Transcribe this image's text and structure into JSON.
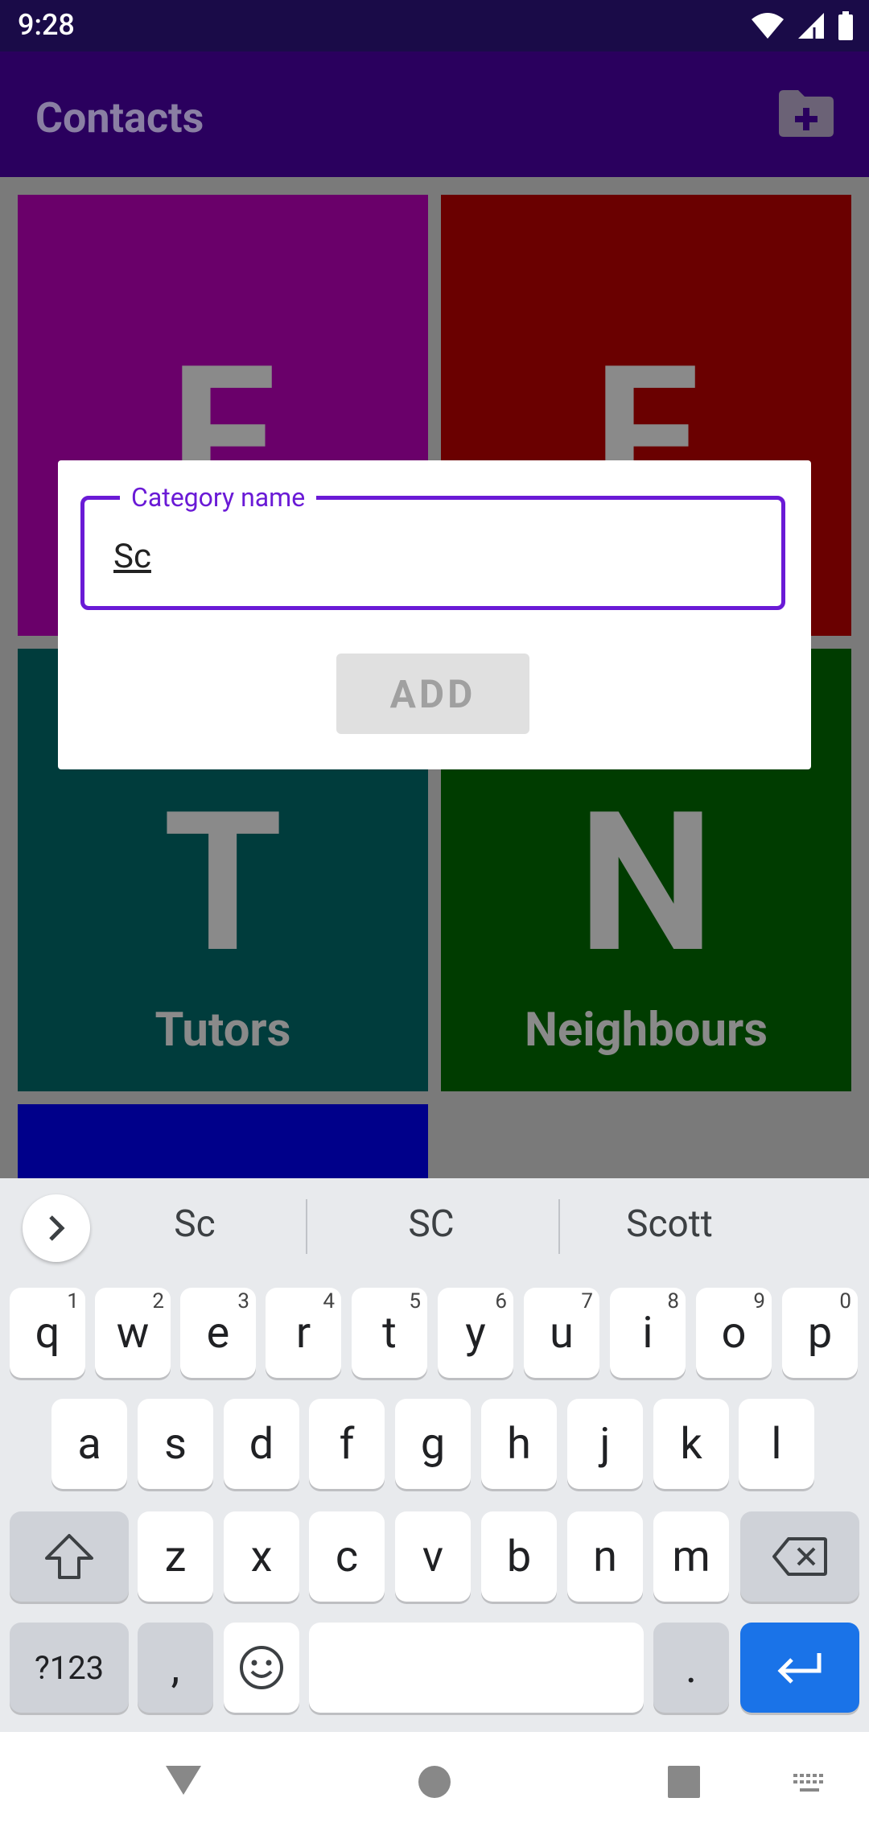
{
  "status_bar": {
    "time": "9:28"
  },
  "app_bar": {
    "title": "Contacts"
  },
  "tiles": [
    {
      "letter": "F",
      "label": "",
      "color": "#6a006a"
    },
    {
      "letter": "F",
      "label": "",
      "color": "#6a0000"
    },
    {
      "letter": "T",
      "label": "Tutors",
      "color": "#003c3c"
    },
    {
      "letter": "N",
      "label": "Neighbours",
      "color": "#003c00"
    }
  ],
  "dialog": {
    "field_label": "Category name",
    "field_value": "Sc",
    "add_label": "ADD"
  },
  "keyboard": {
    "suggestions": [
      "Sc",
      "SC",
      "Scott"
    ],
    "row1": [
      "q",
      "w",
      "e",
      "r",
      "t",
      "y",
      "u",
      "i",
      "o",
      "p"
    ],
    "row1_hints": [
      "1",
      "2",
      "3",
      "4",
      "5",
      "6",
      "7",
      "8",
      "9",
      "0"
    ],
    "row2": [
      "a",
      "s",
      "d",
      "f",
      "g",
      "h",
      "j",
      "k",
      "l"
    ],
    "row3": [
      "z",
      "x",
      "c",
      "v",
      "b",
      "n",
      "m"
    ],
    "symbols_label": "?123",
    "comma_label": ",",
    "period_label": "."
  }
}
